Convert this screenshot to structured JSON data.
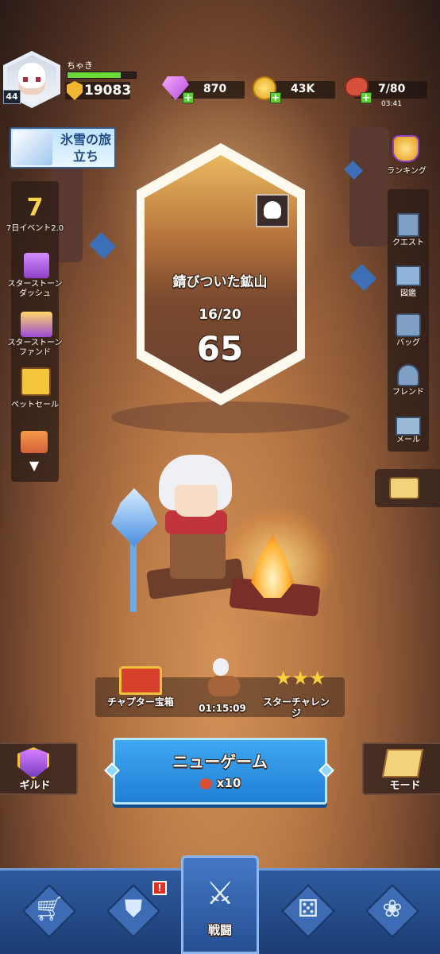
{
  "player": {
    "level": "44",
    "name": "ちゃき",
    "xp_fraction": 0.78,
    "power": "19083"
  },
  "resources": {
    "gems": "870",
    "coins": "43K",
    "stamina": "7/80",
    "stamina_timer": "03:41"
  },
  "event_banner": {
    "label": "氷雪の旅立ち"
  },
  "left_menu": [
    {
      "label": "7日イベント2.0",
      "icon": "seven-day-event-icon",
      "badge": "7"
    },
    {
      "label": "スターストーンダッシュ",
      "icon": "starstone-dash-icon"
    },
    {
      "label": "スターストーンファンド",
      "icon": "starstone-fund-icon"
    },
    {
      "label": "ペットセール",
      "icon": "pet-sale-icon"
    }
  ],
  "right_menu": {
    "ranking": "ランキング",
    "items": [
      {
        "label": "クエスト",
        "icon": "quest-icon"
      },
      {
        "label": "図鑑",
        "icon": "encyclopedia-icon"
      },
      {
        "label": "バッグ",
        "icon": "bag-icon"
      },
      {
        "label": "フレンド",
        "icon": "friend-icon"
      },
      {
        "label": "メール",
        "icon": "mail-icon"
      }
    ]
  },
  "stage": {
    "name": "錆びついた鉱山",
    "progress": "16/20",
    "number": "65"
  },
  "rewards": {
    "chest": "チャプター宝箱",
    "timer": "01:15:09",
    "star_challenge": "スターチャレンジ"
  },
  "new_game": {
    "title": "ニューゲーム",
    "cost": "x10"
  },
  "guild": "ギルド",
  "mode": "モード",
  "bottom_nav": {
    "battle": "戦闘",
    "alert": "!"
  },
  "colors": {
    "accent_blue": "#2f93e6",
    "xp_green": "#6ad93a",
    "alert_red": "#e0301e"
  }
}
